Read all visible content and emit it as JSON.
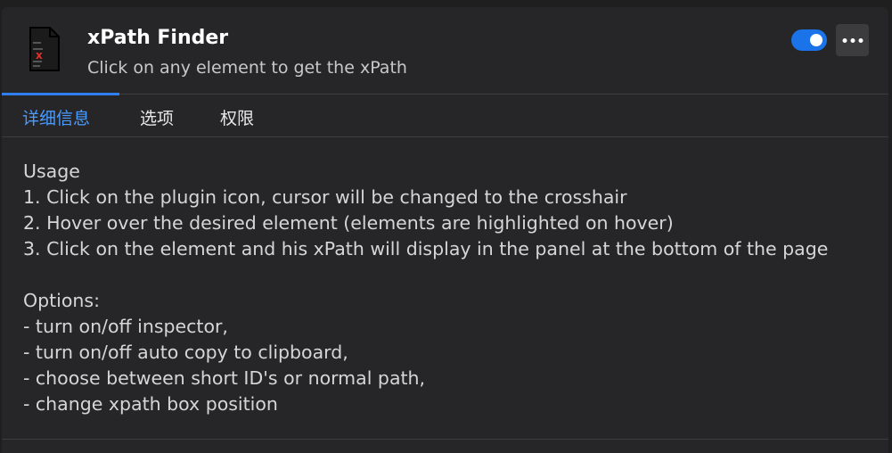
{
  "extension": {
    "title": "xPath Finder",
    "subtitle": "Click on any element to get the xPath",
    "icon": "document-x-icon",
    "enabled": true
  },
  "header": {
    "more_label": "•••"
  },
  "tabs": [
    {
      "label": "详细信息",
      "active": true
    },
    {
      "label": "选项",
      "active": false
    },
    {
      "label": "权限",
      "active": false
    }
  ],
  "description": {
    "usage_heading": "Usage",
    "usage_steps": [
      "1. Click on the plugin icon, cursor will be changed to the crosshair",
      "2. Hover over the desired element (elements are highlighted on hover)",
      "3. Click on the element and his xPath will display in the panel at the bottom of the page"
    ],
    "options_heading": "Options:",
    "options_items": [
      "- turn on/off inspector,",
      "- turn on/off auto copy to clipboard,",
      "- choose between short ID's or normal path,",
      "- change xpath box position"
    ]
  },
  "colors": {
    "background": "#262628",
    "accent": "#1a73e8",
    "active_tab": "#4a9bff",
    "icon_red": "#e0312e"
  }
}
